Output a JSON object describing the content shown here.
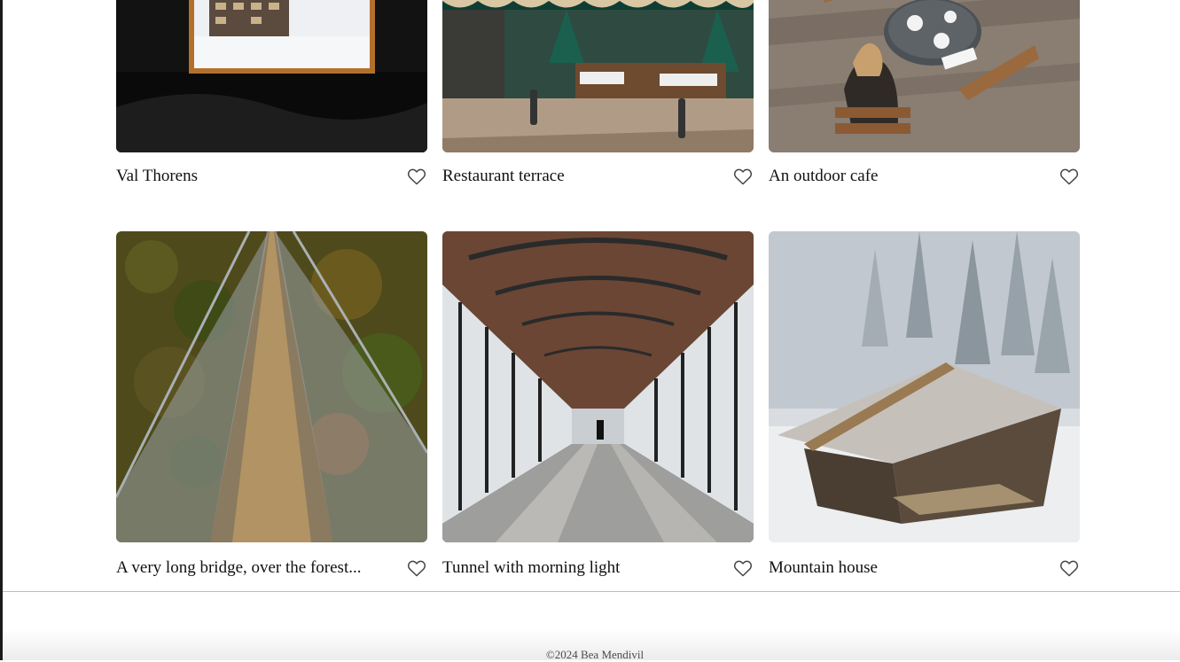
{
  "gallery": {
    "cards": [
      {
        "title": "Val Thorens",
        "image": "val-thorens-photo",
        "liked": false
      },
      {
        "title": "Restaurant terrace",
        "image": "restaurant-terrace-photo",
        "liked": false
      },
      {
        "title": "An outdoor cafe",
        "image": "outdoor-cafe-photo",
        "liked": false
      },
      {
        "title": "A very long bridge, over the forest...",
        "image": "long-bridge-photo",
        "liked": false
      },
      {
        "title": "Tunnel with morning light",
        "image": "tunnel-photo",
        "liked": false
      },
      {
        "title": "Mountain house",
        "image": "mountain-house-photo",
        "liked": false
      }
    ],
    "like_icon": "heart-outline-icon"
  },
  "footer": {
    "text": "©2024 Bea Mendivil"
  },
  "colors": {
    "text": "#111111",
    "icon": "#444444",
    "footer_text": "#4a4a4a",
    "divider": "#bdbdbd"
  }
}
